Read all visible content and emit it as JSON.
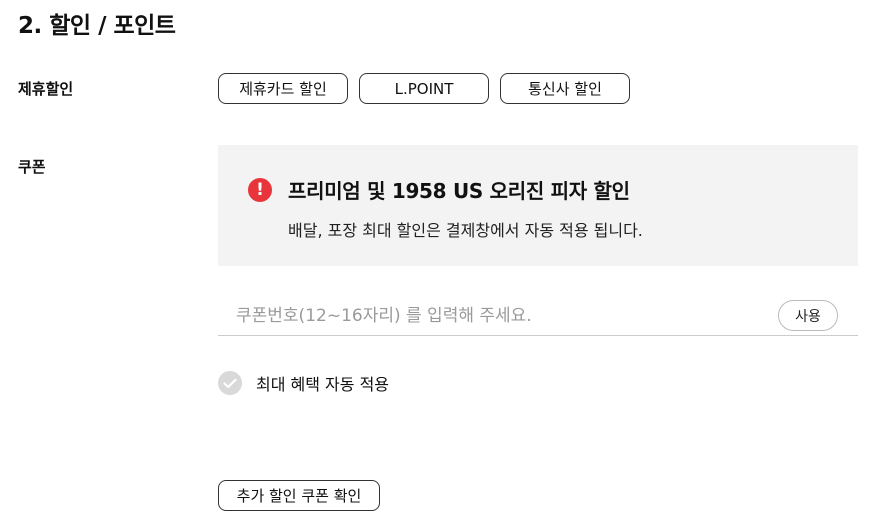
{
  "section": {
    "title": "2. 할인 / 포인트"
  },
  "partner_discount": {
    "label": "제휴할인",
    "options": [
      "제휴카드 할인",
      "L.POINT",
      "통신사 할인"
    ]
  },
  "coupon": {
    "label": "쿠폰",
    "notice": {
      "icon": "exclamation-icon",
      "icon_glyph": "!",
      "title": "프리미엄 및 1958 US 오리진 피자 할인",
      "description": "배달, 포장 최대 할인은 결제창에서 자동 적용 됩니다."
    },
    "input_placeholder": "쿠폰번호(12~16자리) 를 입력해 주세요.",
    "input_value": "",
    "use_button": "사용",
    "auto_apply_label": "최대 혜택 자동 적용",
    "extra_button": "추가 할인 쿠폰 확인"
  },
  "colors": {
    "alert": "#e8343b",
    "notice_bg": "#f3f3f3",
    "check_inactive": "#d9d9d9"
  }
}
